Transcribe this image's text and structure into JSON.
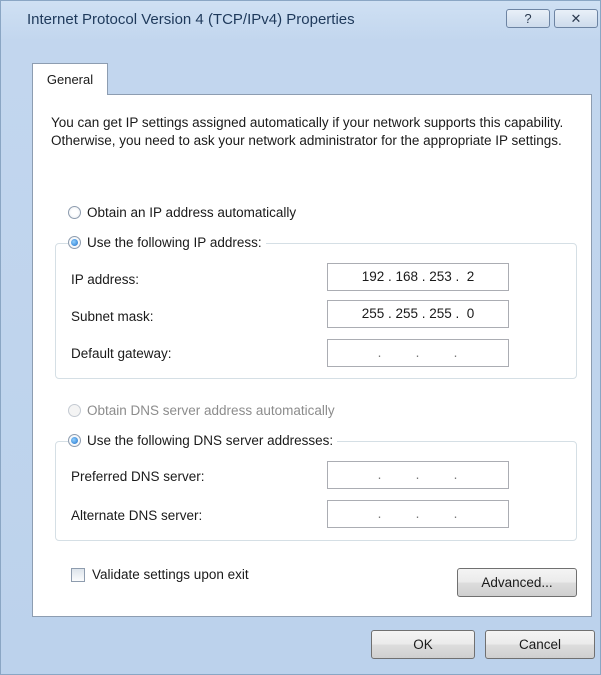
{
  "window": {
    "title": "Internet Protocol Version 4 (TCP/IPv4) Properties",
    "help_button": "?",
    "close_button": "✕"
  },
  "tabs": [
    {
      "label": "General"
    }
  ],
  "description": "You can get IP settings assigned automatically if your network supports this capability. Otherwise, you need to ask your network administrator for the appropriate IP settings.",
  "ip": {
    "auto_option": "Obtain an IP address automatically",
    "manual_option": "Use the following IP address:",
    "selected": "manual",
    "fields": [
      {
        "label": "IP address:",
        "value": "192 . 168 . 253 .  2"
      },
      {
        "label": "Subnet mask:",
        "value": "255 . 255 . 255 .  0"
      },
      {
        "label": "Default gateway:",
        "value": ".       .       ."
      }
    ]
  },
  "dns": {
    "auto_option": "Obtain DNS server address automatically",
    "auto_disabled": true,
    "manual_option": "Use the following DNS server addresses:",
    "selected": "manual",
    "fields": [
      {
        "label": "Preferred DNS server:",
        "value": ".       .       ."
      },
      {
        "label": "Alternate DNS server:",
        "value": ".       .       ."
      }
    ]
  },
  "validate": {
    "label": "Validate settings upon exit",
    "checked": false
  },
  "buttons": {
    "advanced": "Advanced...",
    "ok": "OK",
    "cancel": "Cancel"
  }
}
